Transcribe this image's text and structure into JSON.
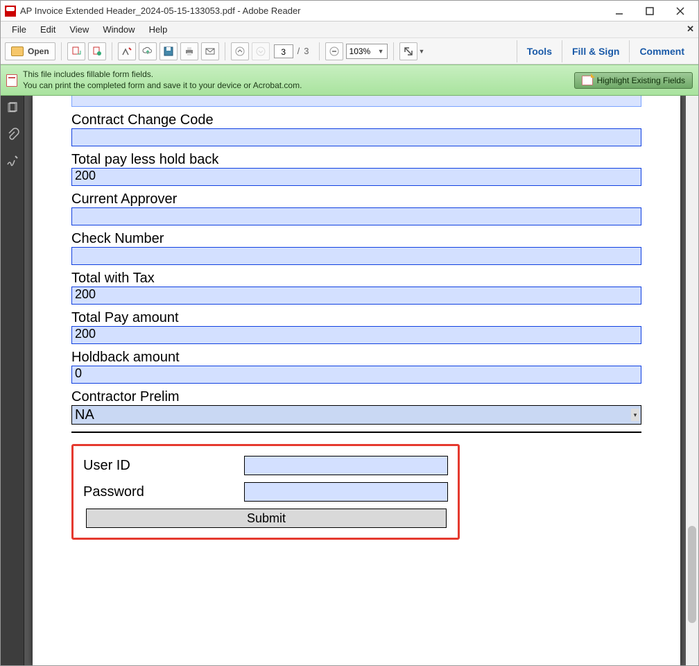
{
  "window": {
    "title": "AP Invoice Extended Header_2024-05-15-133053.pdf - Adobe Reader"
  },
  "menu": {
    "file": "File",
    "edit": "Edit",
    "view": "View",
    "window": "Window",
    "help": "Help"
  },
  "toolbar": {
    "open": "Open",
    "page_current": "3",
    "page_sep": "/",
    "page_total": "3",
    "zoom": "103%",
    "tools": "Tools",
    "fill_sign": "Fill & Sign",
    "comment": "Comment"
  },
  "banner": {
    "line1": "This file includes fillable form fields.",
    "line2": "You can print the completed form and save it to your device or Acrobat.com.",
    "highlight": "Highlight Existing Fields"
  },
  "form": {
    "fields": [
      {
        "label": "Contract Change Code",
        "value": ""
      },
      {
        "label": "Total pay less hold back",
        "value": "200"
      },
      {
        "label": "Current Approver",
        "value": ""
      },
      {
        "label": "Check Number",
        "value": ""
      },
      {
        "label": "Total with Tax",
        "value": "200"
      },
      {
        "label": "Total Pay amount",
        "value": "200"
      },
      {
        "label": "Holdback amount",
        "value": "0"
      }
    ],
    "contractor_prelim_label": "Contractor Prelim",
    "contractor_prelim_value": "NA",
    "user_id_label": "User ID",
    "user_id_value": "",
    "password_label": "Password",
    "password_value": "",
    "submit": "Submit"
  }
}
